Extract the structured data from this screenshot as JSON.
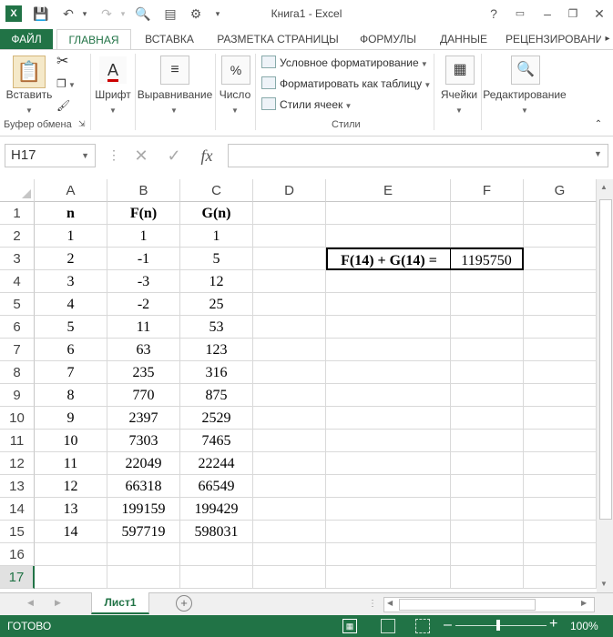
{
  "window": {
    "title": "Книга1 - Excel",
    "help": "?"
  },
  "ribbon_tabs": [
    "ФАЙЛ",
    "ГЛАВНАЯ",
    "ВСТАВКА",
    "РАЗМЕТКА СТРАНИЦЫ",
    "ФОРМУЛЫ",
    "ДАННЫЕ",
    "РЕЦЕНЗИРОВАНИ"
  ],
  "ribbon": {
    "paste": "Вставить",
    "clipboard_group": "Буфер обмена",
    "font": "Шрифт",
    "align": "Выравнивание",
    "number": "Число",
    "number_icon": "%",
    "cond_format": "Условное форматирование",
    "format_table": "Форматировать как таблицу",
    "cell_styles": "Стили ячеек",
    "styles_group": "Стили",
    "cells": "Ячейки",
    "editing": "Редактирование"
  },
  "formula_bar": {
    "name_box": "H17",
    "fx": "fx",
    "value": ""
  },
  "columns": [
    "A",
    "B",
    "C",
    "D",
    "E",
    "F",
    "G"
  ],
  "rows": [
    "1",
    "2",
    "3",
    "4",
    "5",
    "6",
    "7",
    "8",
    "9",
    "10",
    "11",
    "12",
    "13",
    "14",
    "15",
    "16",
    "17"
  ],
  "table": {
    "headers": [
      "n",
      "F(n)",
      "G(n)"
    ],
    "data": [
      [
        "1",
        "1",
        "1"
      ],
      [
        "2",
        "-1",
        "5"
      ],
      [
        "3",
        "-3",
        "12"
      ],
      [
        "4",
        "-2",
        "25"
      ],
      [
        "5",
        "11",
        "53"
      ],
      [
        "6",
        "63",
        "123"
      ],
      [
        "7",
        "235",
        "316"
      ],
      [
        "8",
        "770",
        "875"
      ],
      [
        "9",
        "2397",
        "2529"
      ],
      [
        "10",
        "7303",
        "7465"
      ],
      [
        "11",
        "22049",
        "22244"
      ],
      [
        "12",
        "66318",
        "66549"
      ],
      [
        "13",
        "199159",
        "199429"
      ],
      [
        "14",
        "597719",
        "598031"
      ]
    ]
  },
  "summary": {
    "label": "F(14) + G(14) =",
    "value": "1195750"
  },
  "sheet_tab": "Лист1",
  "status": {
    "ready": "ГОТОВО",
    "zoom": "100%"
  },
  "colors": {
    "excel_green": "#217346"
  }
}
